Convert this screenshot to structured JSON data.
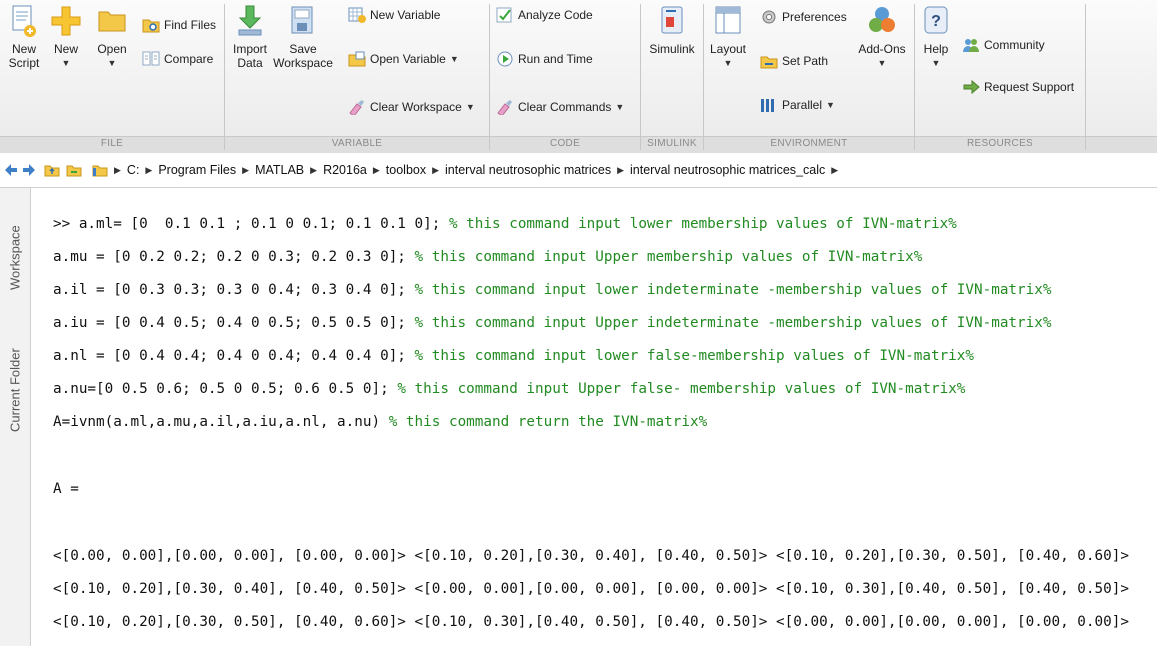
{
  "toolstrip": {
    "file": {
      "caption": "FILE",
      "new_script": [
        "New",
        "Script"
      ],
      "new": "New",
      "open": "Open",
      "find_files": "Find Files",
      "compare": "Compare"
    },
    "variable": {
      "caption": "VARIABLE",
      "import_data": [
        "Import",
        "Data"
      ],
      "save_workspace": [
        "Save",
        "Workspace"
      ],
      "new_variable": "New Variable",
      "open_variable": "Open Variable",
      "clear_workspace": "Clear Workspace"
    },
    "code": {
      "caption": "CODE",
      "analyze_code": "Analyze Code",
      "run_and_time": "Run and Time",
      "clear_commands": "Clear Commands"
    },
    "simulink": {
      "caption": "SIMULINK",
      "simulink": "Simulink"
    },
    "environment": {
      "caption": "ENVIRONMENT",
      "layout": "Layout",
      "preferences": "Preferences",
      "set_path": "Set Path",
      "parallel": "Parallel",
      "add_ons": "Add-Ons"
    },
    "resources": {
      "caption": "RESOURCES",
      "help": "Help",
      "community": "Community",
      "request_support": "Request Support"
    }
  },
  "address": {
    "crumbs": [
      "C:",
      "Program Files",
      "MATLAB",
      "R2016a",
      "toolbox",
      "interval neutrosophic matrices",
      "interval neutrosophic matrices_calc"
    ]
  },
  "side_tabs": {
    "workspace": "Workspace",
    "current_folder": "Current Folder"
  },
  "command_window": {
    "lines": [
      {
        "code": ">> a.ml= [0  0.1 0.1 ; 0.1 0 0.1; 0.1 0.1 0]; ",
        "comment": "% this command input lower membership values of IVN-matrix%"
      },
      {
        "code": "a.mu = [0 0.2 0.2; 0.2 0 0.3; 0.2 0.3 0]; ",
        "comment": "% this command input Upper membership values of IVN-matrix%"
      },
      {
        "code": "a.il = [0 0.3 0.3; 0.3 0 0.4; 0.3 0.4 0]; ",
        "comment": "% this command input lower indeterminate -membership values of IVN-matrix%"
      },
      {
        "code": "a.iu = [0 0.4 0.5; 0.4 0 0.5; 0.5 0.5 0]; ",
        "comment": "% this command input Upper indeterminate -membership values of IVN-matrix%"
      },
      {
        "code": "a.nl = [0 0.4 0.4; 0.4 0 0.4; 0.4 0.4 0]; ",
        "comment": "% this command input lower false-membership values of IVN-matrix%"
      },
      {
        "code": "a.nu=[0 0.5 0.6; 0.5 0 0.5; 0.6 0.5 0]; ",
        "comment": "% this command input Upper false- membership values of IVN-matrix%"
      },
      {
        "code": "A=ivnm(a.ml,a.mu,a.il,a.iu,a.nl, a.nu) ",
        "comment": "% this command return the IVN-matrix%"
      }
    ],
    "result_label": "A =",
    "result_rows": [
      "<[0.00, 0.00],[0.00, 0.00], [0.00, 0.00]> <[0.10, 0.20],[0.30, 0.40], [0.40, 0.50]> <[0.10, 0.20],[0.30, 0.50], [0.40, 0.60]>",
      "<[0.10, 0.20],[0.30, 0.40], [0.40, 0.50]> <[0.00, 0.00],[0.00, 0.00], [0.00, 0.00]> <[0.10, 0.30],[0.40, 0.50], [0.40, 0.50]>",
      "<[0.10, 0.20],[0.30, 0.50], [0.40, 0.60]> <[0.10, 0.30],[0.40, 0.50], [0.40, 0.50]> <[0.00, 0.00],[0.00, 0.00], [0.00, 0.00]>"
    ]
  }
}
